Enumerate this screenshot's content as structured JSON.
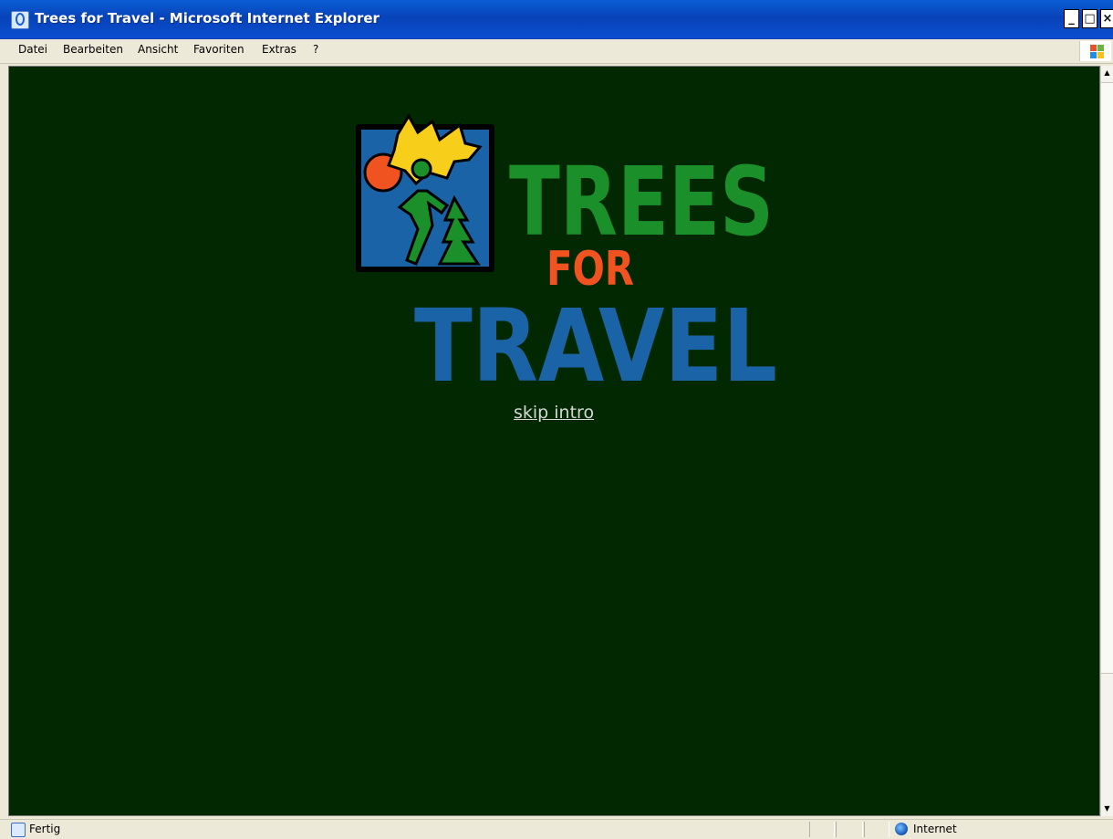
{
  "window": {
    "title": "Trees for Travel - Microsoft Internet Explorer",
    "minimize_label": "_",
    "maximize_label": "□",
    "close_label": "×"
  },
  "menubar": {
    "items": [
      {
        "label": "Datei"
      },
      {
        "label": "Bearbeiten"
      },
      {
        "label": "Ansicht"
      },
      {
        "label": "Favoriten"
      },
      {
        "label": "Extras"
      },
      {
        "label": "?"
      }
    ]
  },
  "page": {
    "background_color": "#012800",
    "logo": {
      "line1": "TREES",
      "line2": "FOR",
      "line3": "TRAVEL",
      "colors": {
        "trees": "#1a8f2a",
        "for": "#f0531f",
        "travel": "#1a63a6",
        "emblem_bg": "#1a63a6",
        "emblem_yellow": "#f7cf1b",
        "emblem_sun": "#f0531f"
      }
    },
    "skip_link": "skip intro"
  },
  "statusbar": {
    "status_text": "Fertig",
    "zone_text": "Internet"
  }
}
